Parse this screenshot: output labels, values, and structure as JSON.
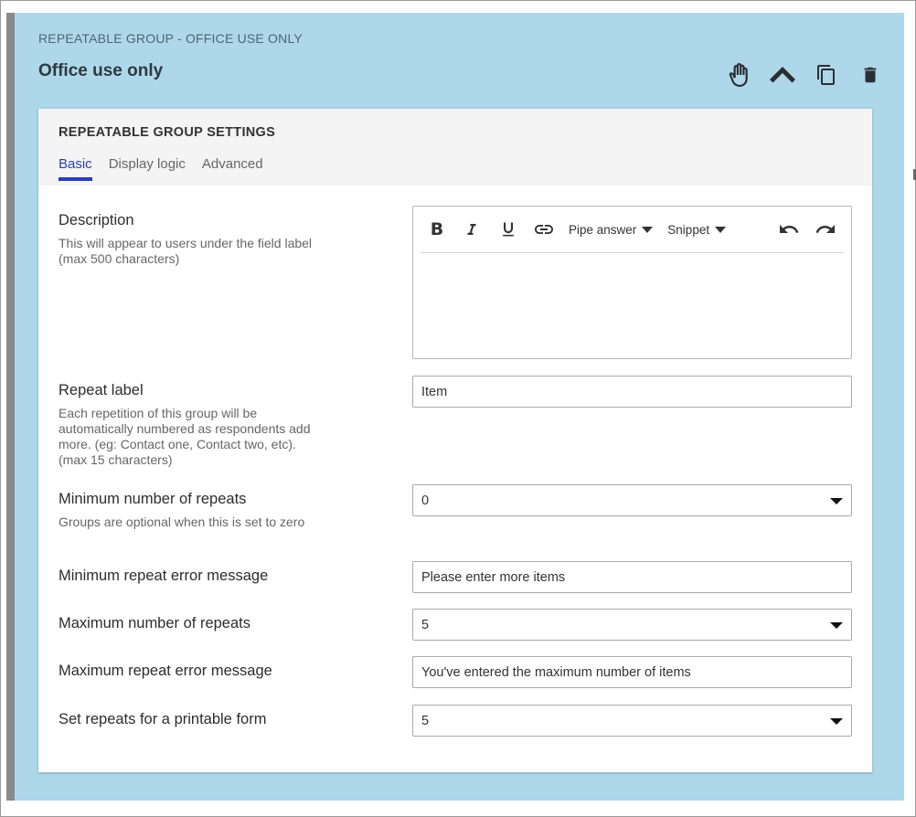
{
  "group": {
    "type_label": "REPEATABLE GROUP - OFFICE USE ONLY",
    "title": "Office use only",
    "actions": [
      {
        "icon": "hand-drag-icon"
      },
      {
        "icon": "chevron-up-icon"
      },
      {
        "icon": "copy-icon"
      },
      {
        "icon": "trash-icon"
      }
    ]
  },
  "settings": {
    "title": "REPEATABLE GROUP SETTINGS",
    "tabs": [
      {
        "label": "Basic",
        "active": true
      },
      {
        "label": "Display logic",
        "active": false
      },
      {
        "label": "Advanced",
        "active": false
      }
    ]
  },
  "editor": {
    "bold": "B",
    "pipe_answer": "Pipe answer",
    "snippet": "Snippet",
    "value": ""
  },
  "fields": {
    "description": {
      "label": "Description",
      "help": "This will appear to users under the field label (max 500 characters)"
    },
    "repeat_label": {
      "label": "Repeat label",
      "help": "Each repetition of this group will be automatically numbered as respondents add more. (eg: Contact one, Contact two, etc). (max 15 characters)",
      "value": "Item"
    },
    "min_repeats": {
      "label": "Minimum number of repeats",
      "help": "Groups are optional when this is set to zero",
      "value": "0"
    },
    "min_error": {
      "label": "Minimum repeat error message",
      "value": "Please enter more items"
    },
    "max_repeats": {
      "label": "Maximum number of repeats",
      "value": "5"
    },
    "max_error": {
      "label": "Maximum repeat error message",
      "value": "You've entered the maximum number of items"
    },
    "printable_repeats": {
      "label": "Set repeats for a printable form",
      "value": "5"
    }
  },
  "colors": {
    "panel_bg": "#aed8ea",
    "accent": "#2b3fb0",
    "left_bar": "#8a8a8a"
  }
}
